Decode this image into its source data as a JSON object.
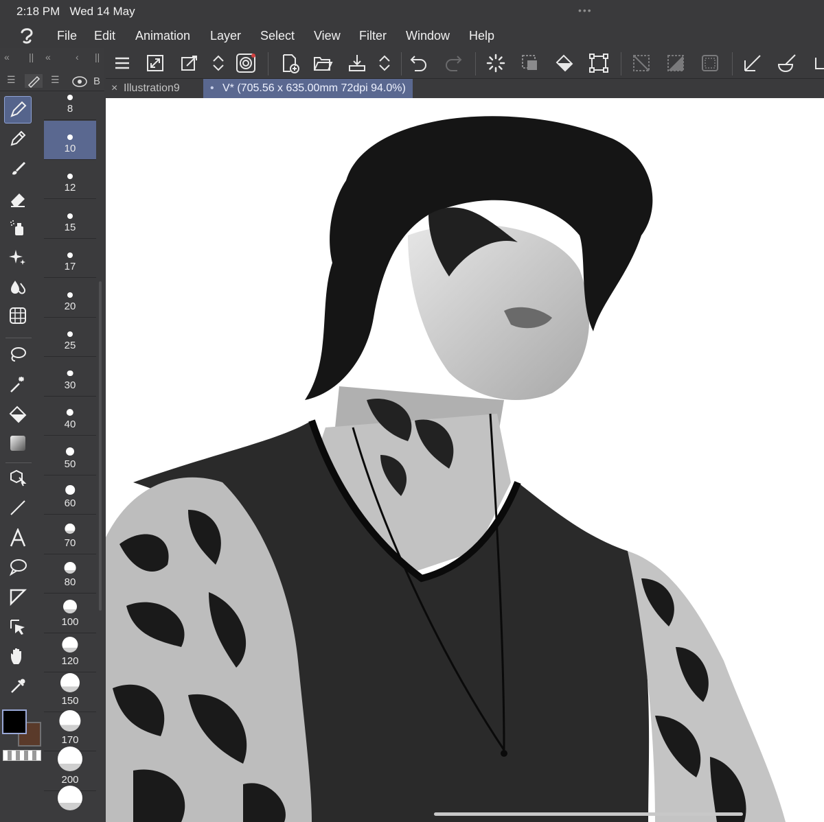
{
  "status": {
    "time": "2:18 PM",
    "date": "Wed 14 May",
    "dots": "•••"
  },
  "menu": [
    "File",
    "Edit",
    "Animation",
    "Layer",
    "Select",
    "View",
    "Filter",
    "Window",
    "Help"
  ],
  "tabs": [
    {
      "label": "Illustration9",
      "close": "×"
    },
    {
      "label": "V* (705.56 x 635.00mm 72dpi 94.0%)",
      "dot": "•"
    }
  ],
  "panel_tab_letter": "B",
  "brush_sizes": [
    "8",
    "10",
    "12",
    "15",
    "17",
    "20",
    "25",
    "30",
    "40",
    "50",
    "60",
    "70",
    "80",
    "100",
    "120",
    "150",
    "170",
    "200",
    ""
  ],
  "selected_brush_size": "10",
  "colors": {
    "main": "#000000",
    "sub": "#5a3a2a",
    "accent": "#5a6890"
  },
  "tools": [
    "pen-tool",
    "pencil-tool",
    "brush-tool",
    "eraser-tool",
    "airbrush-tool",
    "decoration-tool",
    "blend-tool",
    "figure-grid-tool",
    "lasso-tool",
    "auto-select-tool",
    "fill-tool",
    "gradient-tool",
    "3d-object-tool",
    "line-tool",
    "text-tool",
    "balloon-tool",
    "frame-border-tool",
    "operation-tool",
    "hand-tool",
    "eyedropper-tool"
  ],
  "toolbar_icons": [
    "menu-icon",
    "fit-icon",
    "transform-icon",
    "updown-icon",
    "spiral-icon",
    "new-file-icon",
    "open-icon",
    "export-icon",
    "updown2-icon",
    "undo-icon",
    "redo-icon",
    "loading-icon",
    "select-invert-icon",
    "fill-icon",
    "bounding-icon",
    "deselect-icon",
    "clear-icon",
    "border-icon",
    "ruler-icon",
    "paint-icon"
  ]
}
